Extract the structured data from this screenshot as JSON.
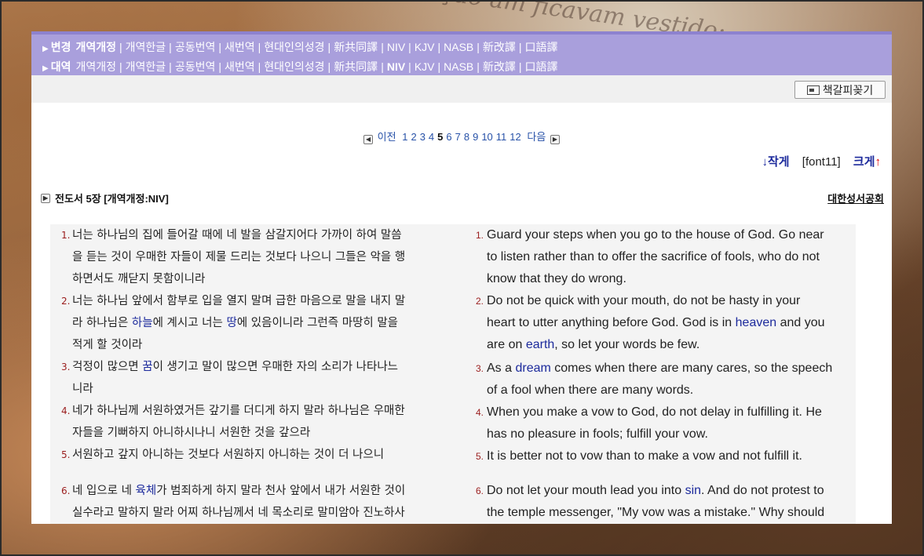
{
  "background_text": "radição     am ficavam     vestido:",
  "version_rows": [
    {
      "label": "변경",
      "items": [
        "개역개정",
        "개역한글",
        "공동번역",
        "새번역",
        "현대인의성경",
        "新共同譯",
        "NIV",
        "KJV",
        "NASB",
        "新改譯",
        "口語譯"
      ],
      "active": "개역개정"
    },
    {
      "label": "대역",
      "items": [
        "개역개정",
        "개역한글",
        "공동번역",
        "새번역",
        "현대인의성경",
        "新共同譯",
        "NIV",
        "KJV",
        "NASB",
        "新改譯",
        "口語譯"
      ],
      "active": "NIV"
    }
  ],
  "bookmark_button": "책갈피꽂기",
  "pager": {
    "prev": "이전",
    "next": "다음",
    "pages": [
      "1",
      "2",
      "3",
      "4",
      "5",
      "6",
      "7",
      "8",
      "9",
      "10",
      "11",
      "12"
    ],
    "current": "5"
  },
  "font_control": {
    "smaller": "작게",
    "current": "[font11]",
    "larger": "크게"
  },
  "chapter_title": "전도서 5장 [개역개정:NIV]",
  "publisher": "대한성서공회",
  "verses_ko": [
    {
      "num": "1.",
      "lines": [
        "너는 하나님의 집에 들어갈 때에 네 발을 삼갈지어다 가까이 하여 말씀",
        "을 듣는 것이 우매한 자들이 제물 드리는 것보다 나으니 그들은 악을 행",
        "하면서도 깨닫지 못함이니라"
      ]
    },
    {
      "num": "2.",
      "lines": [
        "너는 하나님 앞에서 함부로 입을 열지 말며 급한 마음으로 말을 내지 말",
        "라 하나님은 하늘에 계시고 너는 땅에 있음이니라 그런즉 마땅히 말을",
        "적게 할 것이라"
      ]
    },
    {
      "num": "3.",
      "lines": [
        "걱정이 많으면 꿈이 생기고 말이 많으면 우매한 자의 소리가 나타나느",
        "니라"
      ]
    },
    {
      "num": "4.",
      "lines": [
        "네가 하나님께 서원하였거든 갚기를 더디게 하지 말라 하나님은 우매한",
        "자들을 기뻐하지 아니하시나니 서원한 것을 갚으라"
      ]
    },
    {
      "num": "5.",
      "lines": [
        "서원하고 갚지 아니하는 것보다 서원하지 아니하는 것이 더 나으니"
      ]
    },
    {
      "num": "6.",
      "lines": [
        "네 입으로 네 육체가 범죄하게 하지 말라 천사 앞에서 내가 서원한 것이",
        "실수라고 말하지 말라 어찌 하나님께서 네 목소리로 말미암아 진노하사"
      ]
    }
  ],
  "verses_en": [
    {
      "num": "1.",
      "lines": [
        "Guard your steps when you go to the house of God. Go near",
        "to listen rather than to offer the sacrifice of fools, who do not",
        "know that they do wrong."
      ]
    },
    {
      "num": "2.",
      "lines": [
        "Do not be quick with your mouth, do not be hasty in your",
        "heart to utter anything before God. God is in heaven and you",
        "are on earth, so let your words be few."
      ]
    },
    {
      "num": "3.",
      "lines": [
        "As a dream comes when there are many cares, so the speech",
        "of a fool when there are many words."
      ]
    },
    {
      "num": "4.",
      "lines": [
        "When you make a vow to God, do not delay in fulfilling it. He",
        "has no pleasure in fools; fulfill your vow."
      ]
    },
    {
      "num": "5.",
      "lines": [
        "It is better not to vow than to make a vow and not fulfill it."
      ]
    },
    {
      "num": "6.",
      "lines": [
        "Do not let your mouth lead you into sin. And do not protest to",
        "the temple messenger, \"My vow was a mistake.\" Why should"
      ]
    }
  ],
  "keywords": {
    "ko": [
      "하늘",
      "땅",
      "꿈",
      "육체"
    ],
    "en": [
      "heaven",
      "earth",
      "dream",
      "sin"
    ]
  },
  "colors": {
    "topbar": "#a99fdc",
    "link": "#2852a8",
    "keyword": "#1c2a9c",
    "verse_number": "#9a1d1d",
    "arrow_up": "#e00000"
  }
}
